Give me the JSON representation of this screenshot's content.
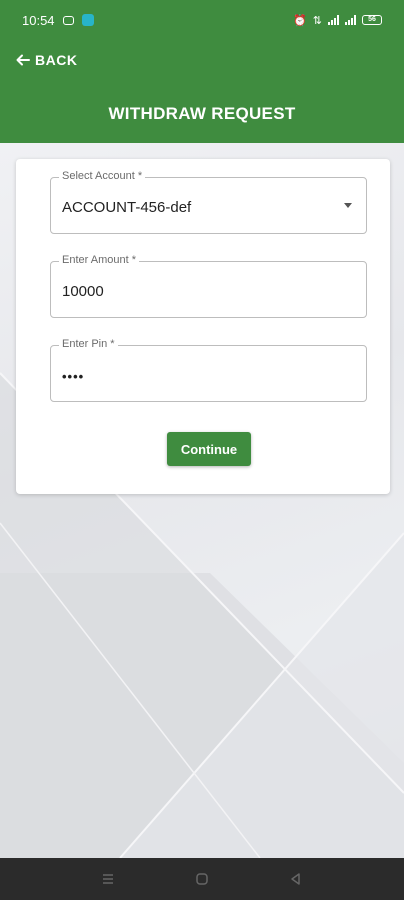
{
  "status_bar": {
    "time": "10:54",
    "battery": "56"
  },
  "header": {
    "back_label": "BACK",
    "title": "WITHDRAW REQUEST"
  },
  "form": {
    "account": {
      "label": "Select Account *",
      "value": "ACCOUNT-456-def"
    },
    "amount": {
      "label": "Enter Amount *",
      "value": "10000"
    },
    "pin": {
      "label": "Enter Pin *",
      "value": "••••"
    },
    "continue_label": "Continue"
  },
  "colors": {
    "primary": "#3f8c3f",
    "background": "#e9eaee",
    "navbar": "#2b2b2b"
  },
  "icons": {
    "back": "arrow-left-icon",
    "dropdown": "chevron-down-icon",
    "nav_menu": "menu-icon",
    "nav_home": "home-icon",
    "nav_back": "triangle-back-icon"
  }
}
